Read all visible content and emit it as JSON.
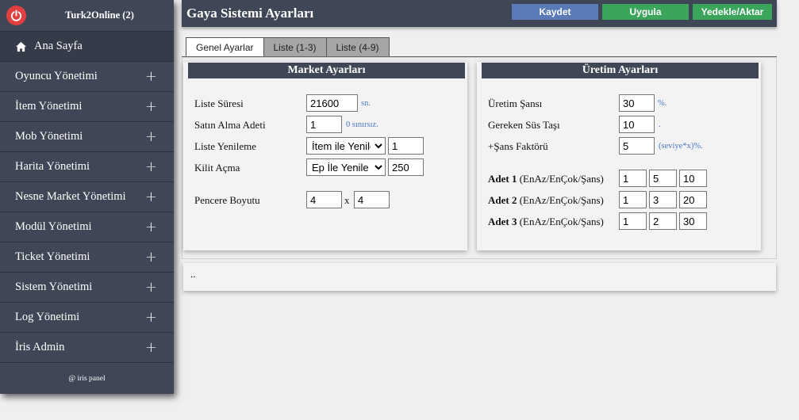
{
  "sidebar": {
    "title": "Turk2Online (2)",
    "items": [
      {
        "label": "Ana Sayfa"
      },
      {
        "label": "Oyuncu Yönetimi"
      },
      {
        "label": "İtem Yönetimi"
      },
      {
        "label": "Mob Yönetimi"
      },
      {
        "label": "Harita Yönetimi"
      },
      {
        "label": "Nesne Market Yönetimi"
      },
      {
        "label": "Modül Yönetimi"
      },
      {
        "label": "Ticket Yönetimi"
      },
      {
        "label": "Sistem Yönetimi"
      },
      {
        "label": "Log Yönetimi"
      },
      {
        "label": "İris Admin"
      }
    ],
    "expand_symbol": "+",
    "footer": "@ iris panel"
  },
  "header": {
    "title": "Gaya Sistemi Ayarları",
    "save_label": "Kaydet",
    "apply_label": "Uygula",
    "backup_label": "Yedekle/Aktar"
  },
  "tabs": [
    {
      "label": "Genel Ayarlar"
    },
    {
      "label": "Liste (1-3)"
    },
    {
      "label": "Liste (4-9)"
    }
  ],
  "market": {
    "heading": "Market Ayarları",
    "list_duration_label": "Liste Süresi",
    "list_duration_value": "21600",
    "list_duration_unit": "sn.",
    "purchase_count_label": "Satın Alma Adeti",
    "purchase_count_value": "1",
    "purchase_count_hint": "0 sınırsız.",
    "list_refresh_label": "Liste Yenileme",
    "list_refresh_option": "İtem ile Yenile",
    "list_refresh_value": "1",
    "unlock_label": "Kilit Açma",
    "unlock_option": "Ep İle Yenile",
    "unlock_value": "250",
    "window_size_label": "Pencere Boyutu",
    "window_w": "4",
    "window_sep": "x",
    "window_h": "4"
  },
  "uretim": {
    "heading": "Üretim Ayarları",
    "chance_label": "Üretim Şansı",
    "chance_value": "30",
    "chance_unit": "%.",
    "stone_label": "Gereken Süs Taşı",
    "stone_value": "10",
    "stone_unit": ".",
    "factor_label": "+Şans Faktörü",
    "factor_value": "5",
    "factor_unit": "(seviye*x)%.",
    "adet_suffix": "(EnAz/EnÇok/Şans)",
    "adet": [
      {
        "name": "Adet 1",
        "min": "1",
        "max": "5",
        "chance": "10"
      },
      {
        "name": "Adet 2",
        "min": "1",
        "max": "3",
        "chance": "20"
      },
      {
        "name": "Adet 3",
        "min": "1",
        "max": "2",
        "chance": "30"
      }
    ]
  },
  "footer_text": ".."
}
